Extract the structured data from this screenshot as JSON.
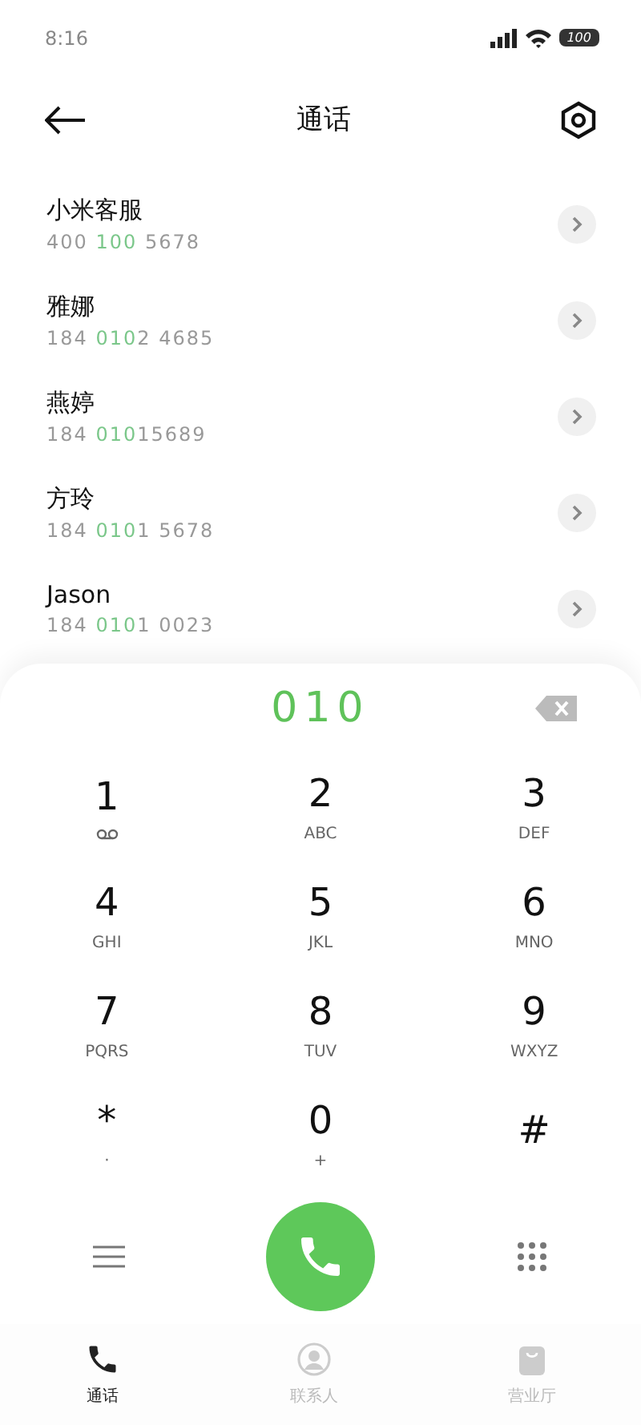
{
  "status_bar": {
    "time": "8:16",
    "battery": "100"
  },
  "header": {
    "title": "通话"
  },
  "contacts": [
    {
      "name": "小米客服",
      "number_before": "400 ",
      "number_match": "100",
      "number_after": " 5678"
    },
    {
      "name": "雅娜",
      "number_before": "184 ",
      "number_match": "010",
      "number_after": "2 4685"
    },
    {
      "name": "燕婷",
      "number_before": "184 ",
      "number_match": "010",
      "number_after": "15689"
    },
    {
      "name": "方玲",
      "number_before": "184 ",
      "number_match": "010",
      "number_after": "1 5678"
    },
    {
      "name": "Jason",
      "number_before": "184 ",
      "number_match": "010",
      "number_after": "1 0023"
    }
  ],
  "dialer": {
    "input": "010",
    "keys": [
      {
        "digit": "1",
        "kind": "voicemail"
      },
      {
        "digit": "2",
        "kind": "letters",
        "sub": "ABC"
      },
      {
        "digit": "3",
        "kind": "letters",
        "sub": "DEF"
      },
      {
        "digit": "4",
        "kind": "letters",
        "sub": "GHI"
      },
      {
        "digit": "5",
        "kind": "letters",
        "sub": "JKL"
      },
      {
        "digit": "6",
        "kind": "letters",
        "sub": "MNO"
      },
      {
        "digit": "7",
        "kind": "letters",
        "sub": "PQRS"
      },
      {
        "digit": "8",
        "kind": "letters",
        "sub": "TUV"
      },
      {
        "digit": "9",
        "kind": "letters",
        "sub": "WXYZ"
      },
      {
        "digit": "*",
        "kind": "letters",
        "sub": "·"
      },
      {
        "digit": "0",
        "kind": "letters",
        "sub": "+"
      },
      {
        "digit": "#",
        "kind": "letters"
      }
    ]
  },
  "tabs": [
    {
      "label": "通话",
      "selected": true,
      "kind": "phone"
    },
    {
      "label": "联系人",
      "selected": false,
      "kind": "contact"
    },
    {
      "label": "营业厅",
      "selected": false,
      "kind": "bag"
    }
  ]
}
